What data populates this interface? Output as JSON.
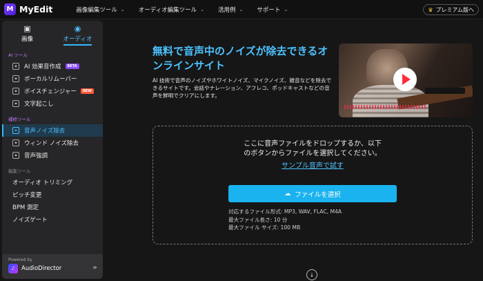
{
  "app": {
    "logo_letter": "M",
    "name": "MyEdit"
  },
  "nav": {
    "items": [
      {
        "label": "画像編集ツール"
      },
      {
        "label": "オーディオ編集ツール"
      },
      {
        "label": "活用例"
      },
      {
        "label": "サポート"
      }
    ],
    "premium_label": "プレミアム版へ"
  },
  "sidebar": {
    "tabs": [
      {
        "label": "画像",
        "icon": "image-icon"
      },
      {
        "label": "オーディオ",
        "icon": "audio-icon",
        "active": true
      }
    ],
    "sections": {
      "ai": {
        "label": "AI ツール",
        "items": [
          {
            "label": "AI 効果音作成",
            "badge": "BETA"
          },
          {
            "label": "ボーカルリムーバー"
          },
          {
            "label": "ボイスチェンジャー",
            "badge": "NEW"
          },
          {
            "label": "文字起こし"
          }
        ]
      },
      "clean": {
        "label": "補修ツール",
        "items": [
          {
            "label": "音声ノイズ除去",
            "active": true
          },
          {
            "label": "ウィンド ノイズ除去"
          },
          {
            "label": "音声強調"
          }
        ]
      },
      "edit": {
        "label": "編集ツール",
        "items": [
          {
            "label": "オーディオ トリミング"
          },
          {
            "label": "ピッチ変更"
          },
          {
            "label": "BPM 測定"
          },
          {
            "label": "ノイズゲート"
          }
        ]
      }
    },
    "powered": {
      "label": "Powered by",
      "name": "AudioDirector"
    }
  },
  "hero": {
    "title": "無料で音声中のノイズが除去できるオンラインサイト",
    "description": "AI 技術で音声のノイズやホワイトノイズ、マイクノイズ、雑音などを除去できるサイトです。会話やナレーション、アフレコ、ポッドキャストなどの音声を鮮明でクリアにします。"
  },
  "upload": {
    "drop_text_line1": "ここに音声ファイルをドロップするか、以下",
    "drop_text_line2": "のボタンからファイルを選択してください。",
    "sample_link": "サンプル音声で試す",
    "button_label": "ファイルを選択",
    "formats": "対応するファイル形式: MP3, WAV, FLAC, M4A",
    "max_length": "最大ファイル長さ: 10 分",
    "max_size": "最大ファイル サイズ: 100 MB"
  },
  "colors": {
    "accent": "#1ab3ef",
    "link": "#4cc3ff",
    "brand": "#7b3cff"
  }
}
